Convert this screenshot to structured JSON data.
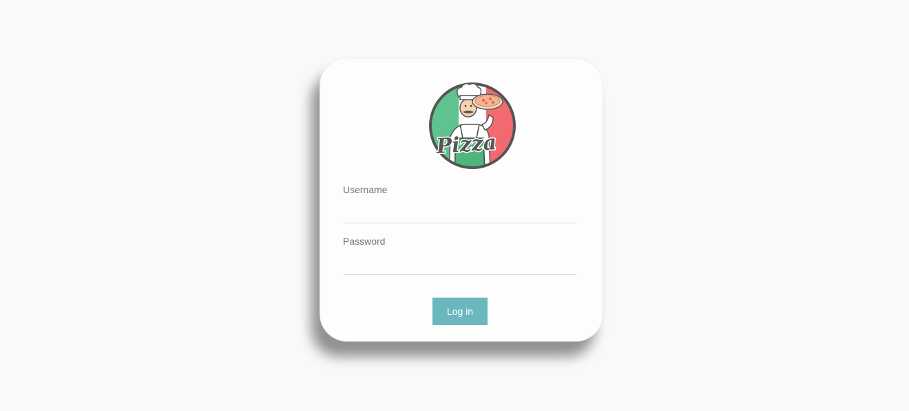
{
  "logo": {
    "icon": "pizza-chef-logo",
    "text": "Pizza",
    "colors": {
      "green": "#5ec38e",
      "white": "#ffffff",
      "red": "#f26a70",
      "outline": "#555555"
    }
  },
  "form": {
    "username_label": "Username",
    "username_value": "",
    "password_label": "Password",
    "password_value": "",
    "login_label": "Log in"
  },
  "colors": {
    "accent": "#6ab8be",
    "background": "#f9f9f9",
    "card": "#fdfdfd"
  }
}
